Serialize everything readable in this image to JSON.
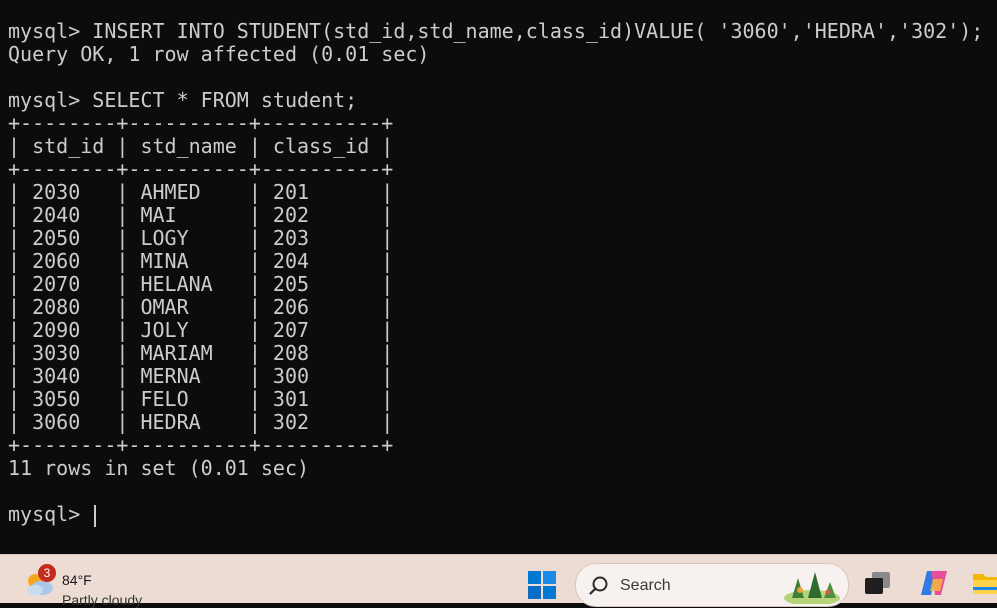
{
  "terminal": {
    "lines": [
      "mysql> INSERT INTO STUDENT(std_id,std_name,class_id)VALUE( '3060','HEDRA','302');",
      "Query OK, 1 row affected (0.01 sec)",
      "",
      "mysql> SELECT * FROM student;",
      "+--------+----------+----------+",
      "| std_id | std_name | class_id |",
      "+--------+----------+----------+",
      "| 2030   | AHMED    | 201      |",
      "| 2040   | MAI      | 202      |",
      "| 2050   | LOGY     | 203      |",
      "| 2060   | MINA     | 204      |",
      "| 2070   | HELANA   | 205      |",
      "| 2080   | OMAR     | 206      |",
      "| 2090   | JOLY     | 207      |",
      "| 3030   | MARIAM   | 208      |",
      "| 3040   | MERNA    | 300      |",
      "| 3050   | FELO     | 301      |",
      "| 3060   | HEDRA    | 302      |",
      "+--------+----------+----------+",
      "11 rows in set (0.01 sec)",
      "",
      "mysql> "
    ]
  },
  "taskbar": {
    "weather": {
      "badge": "3",
      "temperature": "84°F",
      "condition": "Partly cloudy",
      "icon": "partly-cloudy-icon"
    },
    "start_icon": "windows-logo-icon",
    "search": {
      "placeholder": "Search",
      "icon": "search-icon"
    },
    "apps": [
      "task-view-icon",
      "copilot-icon",
      "file-explorer-icon"
    ]
  },
  "colors": {
    "terminal_bg": "#0c0c0c",
    "terminal_fg": "#cccccc",
    "taskbar_bg": "#ecdcd4",
    "accent": "#0078d4",
    "badge": "#c42b1c"
  }
}
